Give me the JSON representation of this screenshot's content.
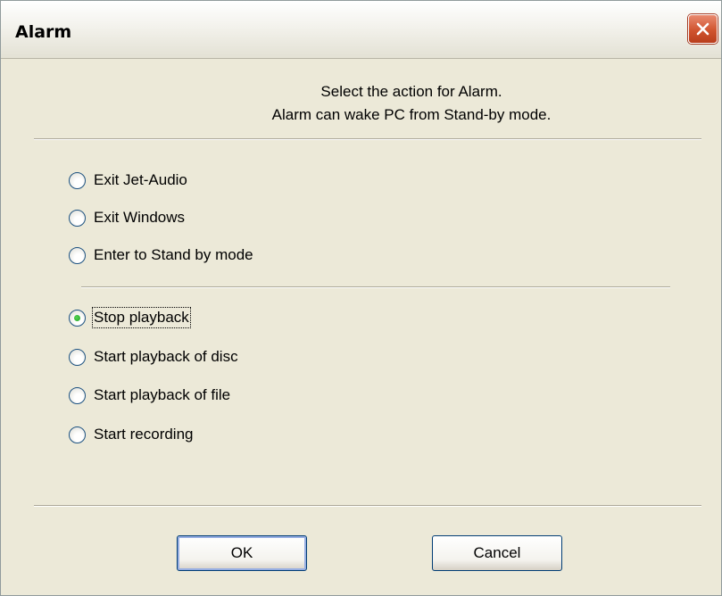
{
  "window": {
    "title": "Alarm"
  },
  "prompt": {
    "line1": "Select the action for Alarm.",
    "line2": "Alarm can wake PC from Stand-by mode."
  },
  "options_system": [
    {
      "label": "Exit Jet-Audio",
      "checked": false
    },
    {
      "label": "Exit Windows",
      "checked": false
    },
    {
      "label": "Enter to Stand by mode",
      "checked": false
    }
  ],
  "options_playback": [
    {
      "label": "Stop playback",
      "checked": true
    },
    {
      "label": "Start playback of disc",
      "checked": false
    },
    {
      "label": "Start playback of file",
      "checked": false
    },
    {
      "label": "Start recording",
      "checked": false
    }
  ],
  "buttons": {
    "ok": "OK",
    "cancel": "Cancel"
  },
  "icons": {
    "close": "close-icon",
    "radio": "radio-button-icon"
  },
  "colors": {
    "close_button": "#d0542f",
    "radio_checked": "#21a121",
    "dialog_bg": "#ece9d8"
  }
}
